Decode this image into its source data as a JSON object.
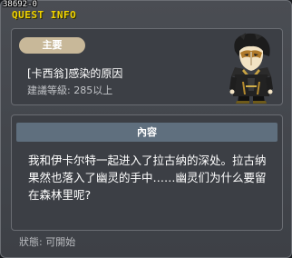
{
  "header": {
    "quest_id": "38692-0",
    "title": "QUEST INFO"
  },
  "quest": {
    "category": "主要",
    "name": "[卡西翁]感染的原因",
    "level_requirement": "建議等級: 285以上",
    "npc_icon": "npc-portrait-masked-man"
  },
  "description": {
    "header": "內容",
    "text": "我和伊卡尔特一起进入了拉古纳的深处。拉古纳果然也落入了幽灵的手中……幽灵们为什么要留在森林里呢?"
  },
  "status": {
    "text": "狀態: 可開始"
  },
  "colors": {
    "title_yellow": "#f0d200",
    "badge_tan": "#c8b899",
    "header_blue": "#5f6f7e"
  }
}
